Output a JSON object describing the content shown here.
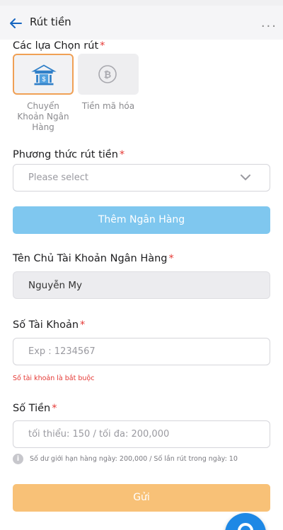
{
  "header": {
    "title": "Rút tiền",
    "more": "..."
  },
  "options": {
    "label": "Các lựa Chọn rút",
    "required": "*",
    "items": [
      {
        "caption": "Chuyển Khoản Ngân Hàng",
        "icon": "bank-icon",
        "selected": true
      },
      {
        "caption": "Tiền mã hóa",
        "icon": "bitcoin-icon",
        "selected": false
      }
    ]
  },
  "method": {
    "label": "Phương thức rút tiền",
    "required": "*",
    "placeholder": "Please select"
  },
  "add_bank_button": "Thêm Ngân Hàng",
  "account_holder": {
    "label": "Tên Chủ Tài Khoản Ngân Hàng",
    "required": "*",
    "value": "Nguyễn My"
  },
  "account_number": {
    "label": "Số Tài Khoản",
    "required": "*",
    "placeholder": "Exp : 1234567",
    "error": "Số tài khoản là bắt buộc"
  },
  "amount": {
    "label": "Số Tiền",
    "required": "*",
    "placeholder": "tối thiểu: 150 / tối đa: 200,000",
    "info": "Số dư giới hạn hàng ngày: 200,000 / Số lần rút trong ngày: 10"
  },
  "submit_button": "Gửi",
  "colors": {
    "accent_orange": "#f8c177",
    "accent_blue": "#7fc7ef",
    "error": "#e53935",
    "fab": "#1e88e5"
  }
}
